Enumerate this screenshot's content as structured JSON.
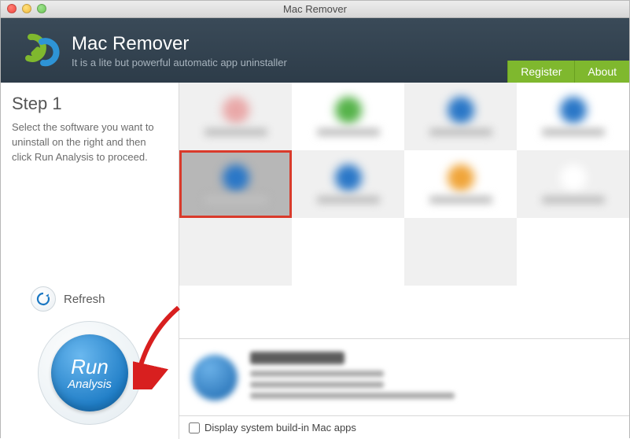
{
  "window": {
    "title": "Mac Remover"
  },
  "header": {
    "title": "Mac Remover",
    "subtitle": "It is a lite but powerful automatic app uninstaller",
    "buttons": {
      "register": "Register",
      "about": "About"
    }
  },
  "sidebar": {
    "step_title": "Step 1",
    "instructions": "Select the software you want to uninstall on the right and then click Run Analysis to proceed.",
    "refresh_label": "Refresh",
    "run_label_line1": "Run",
    "run_label_line2": "Analysis"
  },
  "footer": {
    "checkbox_label": "Display system build-in Mac apps",
    "checked": false
  },
  "grid": {
    "rows": 2,
    "cols": 4,
    "selected_index": 4,
    "icon_colors": [
      "#e9a8a8",
      "#56b34a",
      "#2a77c7",
      "#2a77c7",
      "#2a77c7",
      "#2a77c7",
      "#f0a53a",
      "#ffffff"
    ]
  }
}
